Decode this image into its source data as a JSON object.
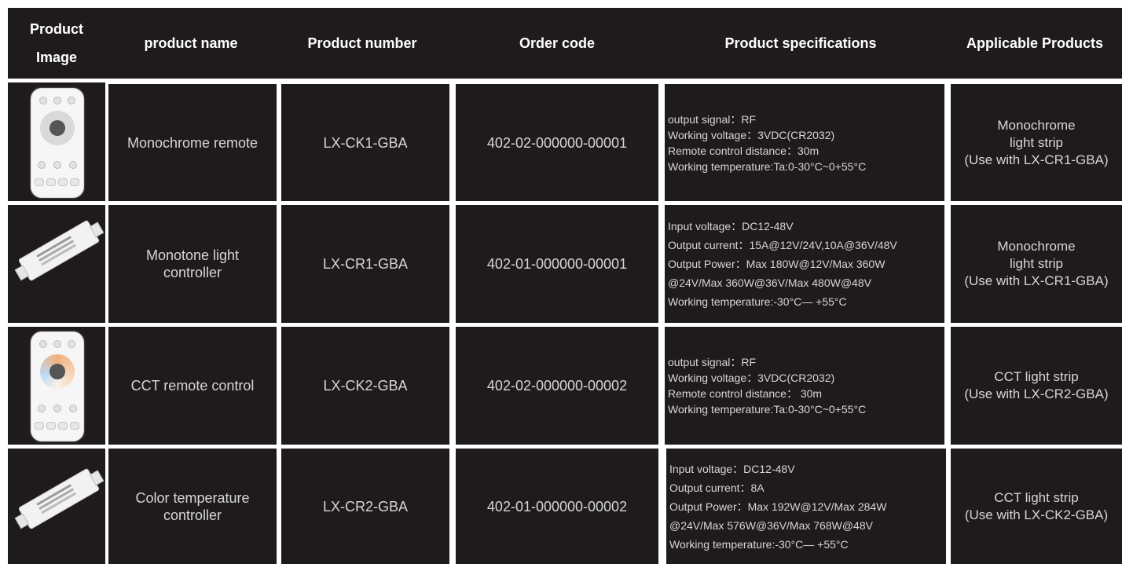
{
  "headers": [
    "Product\nImage",
    "product name",
    "Product number",
    "Order code",
    "Product specifications",
    "Applicable Products"
  ],
  "rows": [
    {
      "image": "remote-monochrome",
      "name": "Monochrome remote",
      "number": "LX-CK1-GBA",
      "order": "402-02-000000-00001",
      "spec": [
        "output signal：RF",
        "Working voltage：3VDC(CR2032)",
        "Remote control distance：30m",
        "Working temperature:Ta:0-30°C~0+55°C"
      ],
      "applicable": [
        "Monochrome",
        "light strip",
        "(Use with LX-CR1-GBA)"
      ]
    },
    {
      "image": "controller",
      "name": "Monotone light controller",
      "number": "LX-CR1-GBA",
      "order": "402-01-000000-00001",
      "spec": [
        "Input voltage：DC12-48V",
        "Output current：15A@12V/24V,10A@36V/48V",
        "Output Power：Max 180W@12V/Max 360W",
        "@24V/Max 360W@36V/Max 480W@48V",
        "Working temperature:-30°C— +55°C"
      ],
      "applicable": [
        "Monochrome",
        "light strip",
        "(Use with LX-CR1-GBA)"
      ]
    },
    {
      "image": "remote-cct",
      "name": "CCT remote control",
      "number": "LX-CK2-GBA",
      "order": "402-02-000000-00002",
      "spec": [
        "output signal：RF",
        "Working voltage：3VDC(CR2032)",
        "Remote control distance： 30m",
        "Working temperature:Ta:0-30°C~0+55°C"
      ],
      "applicable": [
        "CCT light strip",
        "(Use with LX-CR2-GBA)"
      ]
    },
    {
      "image": "controller",
      "name": "Color temperature controller",
      "number": "LX-CR2-GBA",
      "order": "402-01-000000-00002",
      "spec": [
        "Input voltage：DC12-48V",
        "Output current：8A",
        "Output Power：Max 192W@12V/Max 284W",
        "@24V/Max 576W@36V/Max 768W@48V",
        "Working temperature:-30°C— +55°C"
      ],
      "applicable": [
        "CCT light strip",
        "(Use with LX-CK2-GBA)"
      ]
    }
  ]
}
